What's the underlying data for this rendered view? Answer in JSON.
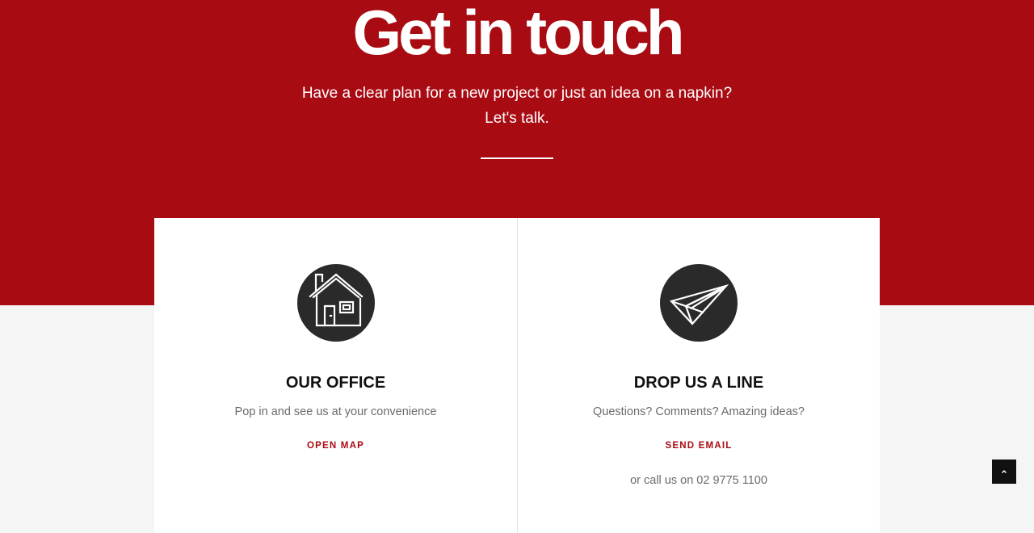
{
  "hero": {
    "title": "Get in touch",
    "subtitle_line1": "Have a clear plan for a new project or just an idea on a napkin?",
    "subtitle_line2": "Let's talk."
  },
  "cards": [
    {
      "icon": "house-icon",
      "title": "OUR OFFICE",
      "text": "Pop in and see us at your convenience",
      "link_label": "OPEN MAP"
    },
    {
      "icon": "paper-plane-icon",
      "title": "DROP US A LINE",
      "text": "Questions? Comments? Amazing ideas?",
      "link_label": "SEND EMAIL",
      "extra": "or call us on 02 9775 1100"
    }
  ],
  "scroll_top": {
    "icon": "chevron-up-icon"
  },
  "colors": {
    "brand_red": "#a90b13",
    "icon_bg": "#2a2a2a",
    "page_bg": "#f5f5f5"
  }
}
